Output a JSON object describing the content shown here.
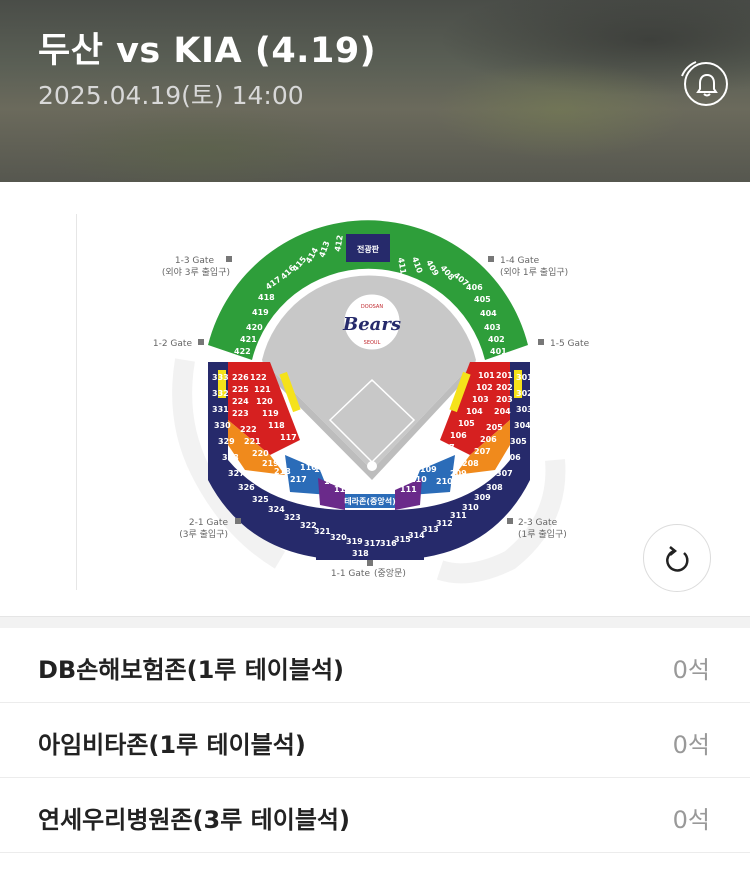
{
  "header": {
    "title": "두산 vs KIA (4.19)",
    "datetime": "2025.04.19(토) 14:00"
  },
  "map": {
    "scoreboard": "전광판",
    "logo_text": "Bears",
    "logo_top": "DOOSAN",
    "logo_bottom": "SEOUL",
    "terrace": "테라존(중앙석)",
    "gates": {
      "g13": "1-3 Gate",
      "g13_sub": "(외야 3루 출입구)",
      "g14": "1-4 Gate",
      "g14_sub": "(외야 1루 출입구)",
      "g12": "1-2 Gate",
      "g15": "1-5 Gate",
      "g21": "2-1 Gate",
      "g21_sub": "(3루 출입구)",
      "g23": "2-3 Gate",
      "g23_sub": "(1루 출입구)",
      "g11": "1-1 Gate",
      "g11_sub": "(중앙문)"
    },
    "sections": {
      "outfield_left": [
        "412",
        "413",
        "414",
        "415",
        "416",
        "417",
        "418",
        "419",
        "420",
        "421",
        "422"
      ],
      "outfield_right": [
        "411",
        "410",
        "409",
        "408",
        "407",
        "406",
        "405",
        "404",
        "403",
        "402",
        "401"
      ],
      "red_left": [
        "226",
        "225",
        "224",
        "223",
        "122",
        "121",
        "120",
        "119",
        "118",
        "117"
      ],
      "red_right": [
        "101",
        "102",
        "103",
        "104",
        "105",
        "106",
        "201",
        "202",
        "203",
        "204"
      ],
      "navy_left": [
        "332",
        "331",
        "330",
        "329",
        "328",
        "327",
        "326",
        "325",
        "324",
        "323",
        "322",
        "321",
        "320",
        "319"
      ],
      "navy_right": [
        "301",
        "302",
        "303",
        "304",
        "305",
        "306",
        "307",
        "308",
        "309",
        "310",
        "311",
        "312",
        "313",
        "314",
        "315",
        "316",
        "317",
        "318"
      ],
      "orange_left": [
        "222",
        "221",
        "220",
        "219"
      ],
      "orange_right": [
        "205",
        "206",
        "207",
        "208"
      ],
      "blue_left": [
        "218",
        "217",
        "216",
        "115",
        "114"
      ],
      "blue_right": [
        "107",
        "108",
        "109",
        "209",
        "210"
      ]
    }
  },
  "zones": [
    {
      "name": "DB손해보험존(1루 테이블석)",
      "count": "0석"
    },
    {
      "name": "아임비타존(1루 테이블석)",
      "count": "0석"
    },
    {
      "name": "연세우리병원존(3루 테이블석)",
      "count": "0석"
    }
  ],
  "colors": {
    "green": "#2e9e3a",
    "red": "#d62020",
    "navy": "#262a6b",
    "orange": "#f08a1c",
    "blue": "#2b6cb8",
    "purple": "#6a2a8a",
    "yellow": "#f5e21a"
  }
}
